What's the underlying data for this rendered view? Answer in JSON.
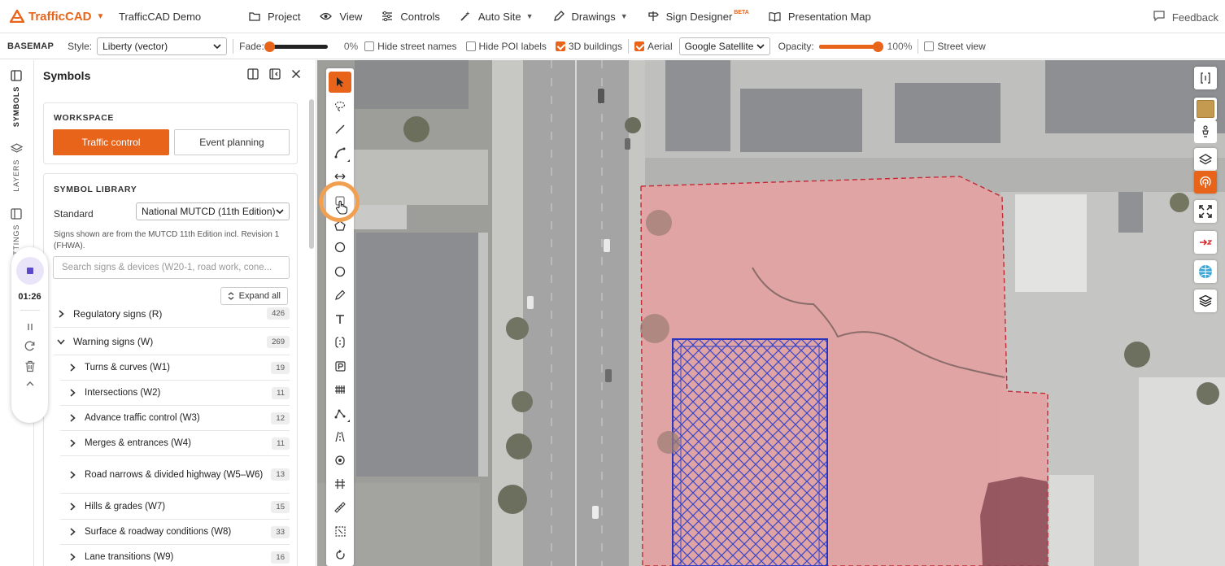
{
  "brand": {
    "name": "TrafficCAD",
    "project": "TrafficCAD Demo",
    "accent": "#e8641b"
  },
  "nav": {
    "project": "Project",
    "view": "View",
    "controls": "Controls",
    "autosite": "Auto Site",
    "drawings": "Drawings",
    "sign_designer": "Sign Designer",
    "beta": "BETA",
    "presentation": "Presentation Map",
    "feedback": "Feedback"
  },
  "basemap": {
    "label": "BASEMAP",
    "style_label": "Style:",
    "style_value": "Liberty (vector)",
    "fade_label": "Fade:",
    "fade_value": "0%",
    "fade_level": 0,
    "hide_street": "Hide street names",
    "hide_poi": "Hide POI labels",
    "buildings3d": "3D buildings",
    "aerial": "Aerial",
    "provider": "Google Satellite",
    "opacity_label": "Opacity:",
    "opacity_value": "100%",
    "opacity_level": 1,
    "street_view": "Street view"
  },
  "rail": {
    "symbols": "SYMBOLS",
    "layers": "LAYERS",
    "settings": "SETTINGS"
  },
  "recorder": {
    "time": "01:26"
  },
  "panel": {
    "title": "Symbols",
    "workspace": {
      "heading": "WORKSPACE",
      "traffic": "Traffic control",
      "event": "Event planning"
    },
    "library": {
      "heading": "SYMBOL LIBRARY",
      "standard_label": "Standard",
      "standard_value": "National MUTCD (11th Edition)",
      "note": "Signs shown are from the MUTCD 11th Edition incl. Revision 1 (FHWA).",
      "search_placeholder": "Search signs & devices (W20-1, road work, cone...",
      "expand_all": "Expand all"
    },
    "categories": [
      {
        "label": "Regulatory signs (R)",
        "count": "426"
      },
      {
        "label": "Warning signs (W)",
        "count": "269"
      },
      {
        "label": "Turns & curves (W1)",
        "count": "19"
      },
      {
        "label": "Intersections (W2)",
        "count": "11"
      },
      {
        "label": "Advance traffic control (W3)",
        "count": "12"
      },
      {
        "label": "Merges & entrances (W4)",
        "count": "11"
      },
      {
        "label": "Road narrows & divided highway (W5–W6)",
        "count": "13"
      },
      {
        "label": "Hills & grades (W7)",
        "count": "15"
      },
      {
        "label": "Surface & roadway conditions (W8)",
        "count": "33"
      },
      {
        "label": "Lane transitions (W9)",
        "count": "16"
      }
    ]
  }
}
